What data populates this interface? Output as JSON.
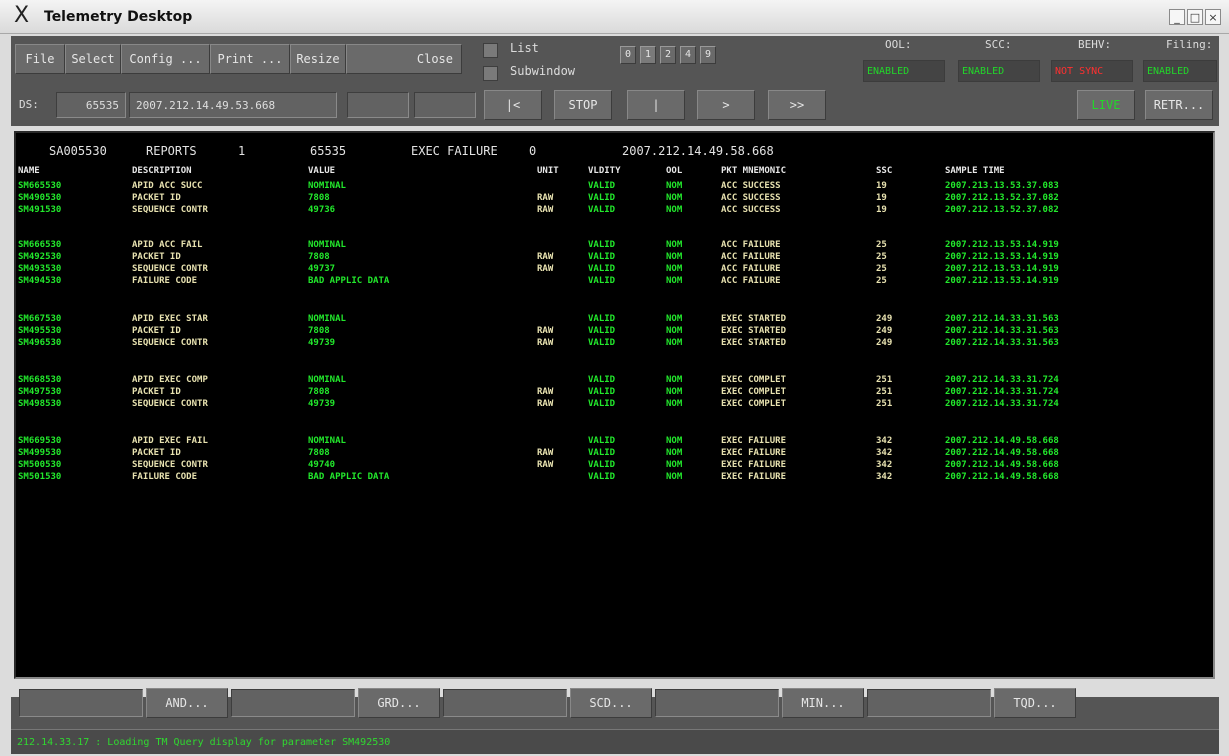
{
  "window": {
    "title": "Telemetry Desktop",
    "min_label": "_",
    "max_label": "□",
    "close_label": "×",
    "app_icon": "X"
  },
  "menu": {
    "file": "File",
    "select": "Select",
    "config": "Config ...",
    "print": "Print ...",
    "resize": "Resize",
    "close": "Close",
    "list": "List",
    "subwindow": "Subwindow",
    "pages": [
      "0",
      "1",
      "2",
      "4",
      "9"
    ]
  },
  "status": {
    "ool_label": "OOL:",
    "ool_value": "ENABLED",
    "scc_label": "SCC:",
    "scc_value": "ENABLED",
    "behv_label": "BEHV:",
    "behv_value": "NOT SYNC",
    "filing_label": "Filing:",
    "filing_value": "ENABLED",
    "colors": {
      "enabled": "#22d82a",
      "not_sync": "#ff3030"
    }
  },
  "nav": {
    "ds_label": "DS:",
    "ds_value": "65535",
    "time": "2007.212.14.49.53.668",
    "first": "|<",
    "stop": "STOP",
    "pause": "|",
    "next": ">",
    "last": ">>",
    "live": "LIVE",
    "retr": "RETR..."
  },
  "header": {
    "id": "SA005530",
    "type": "REPORTS",
    "count": "1",
    "code": "65535",
    "event": "EXEC FAILURE",
    "status": "0",
    "time": "2007.212.14.49.58.668"
  },
  "columns": {
    "name": "NAME",
    "description": "DESCRIPTION",
    "value": "VALUE",
    "unit": "UNIT",
    "validity": "VLDITY",
    "ool": "OOL",
    "mnemonic": "PKT MNEMONIC",
    "ssc": "SSC",
    "time": "SAMPLE TIME"
  },
  "rows": [
    {
      "name": "SM665530",
      "desc": "APID ACC SUCC",
      "value": "NOMINAL",
      "unit": "",
      "vld": "VALID",
      "ool": "NOM",
      "mn": "ACC SUCCESS",
      "ssc": "19",
      "time": "2007.213.13.53.37.083"
    },
    {
      "name": "SM490530",
      "desc": "PACKET ID",
      "value": "7808",
      "unit": "RAW",
      "vld": "VALID",
      "ool": "NOM",
      "mn": "ACC SUCCESS",
      "ssc": "19",
      "time": "2007.212.13.52.37.082"
    },
    {
      "name": "SM491530",
      "desc": "SEQUENCE CONTR",
      "value": "49736",
      "unit": "RAW",
      "vld": "VALID",
      "ool": "NOM",
      "mn": "ACC SUCCESS",
      "ssc": "19",
      "time": "2007.212.13.52.37.082"
    },
    {
      "name": "SM666530",
      "desc": "APID ACC FAIL",
      "value": "NOMINAL",
      "unit": "",
      "vld": "VALID",
      "ool": "NOM",
      "mn": "ACC FAILURE",
      "ssc": "25",
      "time": "2007.212.13.53.14.919"
    },
    {
      "name": "SM492530",
      "desc": "PACKET ID",
      "value": "7808",
      "unit": "RAW",
      "vld": "VALID",
      "ool": "NOM",
      "mn": "ACC FAILURE",
      "ssc": "25",
      "time": "2007.212.13.53.14.919"
    },
    {
      "name": "SM493530",
      "desc": "SEQUENCE CONTR",
      "value": "49737",
      "unit": "RAW",
      "vld": "VALID",
      "ool": "NOM",
      "mn": "ACC FAILURE",
      "ssc": "25",
      "time": "2007.212.13.53.14.919"
    },
    {
      "name": "SM494530",
      "desc": "FAILURE CODE",
      "value": "BAD APPLIC DATA",
      "unit": "",
      "vld": "VALID",
      "ool": "NOM",
      "mn": "ACC FAILURE",
      "ssc": "25",
      "time": "2007.212.13.53.14.919"
    },
    {
      "name": "SM667530",
      "desc": "APID EXEC STAR",
      "value": "NOMINAL",
      "unit": "",
      "vld": "VALID",
      "ool": "NOM",
      "mn": "EXEC STARTED",
      "ssc": "249",
      "time": "2007.212.14.33.31.563"
    },
    {
      "name": "SM495530",
      "desc": "PACKET ID",
      "value": "7808",
      "unit": "RAW",
      "vld": "VALID",
      "ool": "NOM",
      "mn": "EXEC STARTED",
      "ssc": "249",
      "time": "2007.212.14.33.31.563"
    },
    {
      "name": "SM496530",
      "desc": "SEQUENCE CONTR",
      "value": "49739",
      "unit": "RAW",
      "vld": "VALID",
      "ool": "NOM",
      "mn": "EXEC STARTED",
      "ssc": "249",
      "time": "2007.212.14.33.31.563"
    },
    {
      "name": "SM668530",
      "desc": "APID EXEC COMP",
      "value": "NOMINAL",
      "unit": "",
      "vld": "VALID",
      "ool": "NOM",
      "mn": "EXEC COMPLET",
      "ssc": "251",
      "time": "2007.212.14.33.31.724"
    },
    {
      "name": "SM497530",
      "desc": "PACKET ID",
      "value": "7808",
      "unit": "RAW",
      "vld": "VALID",
      "ool": "NOM",
      "mn": "EXEC COMPLET",
      "ssc": "251",
      "time": "2007.212.14.33.31.724"
    },
    {
      "name": "SM498530",
      "desc": "SEQUENCE CONTR",
      "value": "49739",
      "unit": "RAW",
      "vld": "VALID",
      "ool": "NOM",
      "mn": "EXEC COMPLET",
      "ssc": "251",
      "time": "2007.212.14.33.31.724"
    },
    {
      "name": "SM669530",
      "desc": "APID EXEC FAIL",
      "value": "NOMINAL",
      "unit": "",
      "vld": "VALID",
      "ool": "NOM",
      "mn": "EXEC FAILURE",
      "ssc": "342",
      "time": "2007.212.14.49.58.668"
    },
    {
      "name": "SM499530",
      "desc": "PACKET ID",
      "value": "7808",
      "unit": "RAW",
      "vld": "VALID",
      "ool": "NOM",
      "mn": "EXEC FAILURE",
      "ssc": "342",
      "time": "2007.212.14.49.58.668"
    },
    {
      "name": "SM500530",
      "desc": "SEQUENCE CONTR",
      "value": "49740",
      "unit": "RAW",
      "vld": "VALID",
      "ool": "NOM",
      "mn": "EXEC FAILURE",
      "ssc": "342",
      "time": "2007.212.14.49.58.668"
    },
    {
      "name": "SM501530",
      "desc": "FAILURE CODE",
      "value": "BAD APPLIC DATA",
      "unit": "",
      "vld": "VALID",
      "ool": "NOM",
      "mn": "EXEC FAILURE",
      "ssc": "342",
      "time": "2007.212.14.49.58.668"
    }
  ],
  "query": {
    "and": "AND...",
    "grd": "GRD...",
    "scd": "SCD...",
    "min": "MIN...",
    "tqd": "TQD..."
  },
  "message": "212.14.33.17 : Loading TM Query display for parameter SM492530"
}
